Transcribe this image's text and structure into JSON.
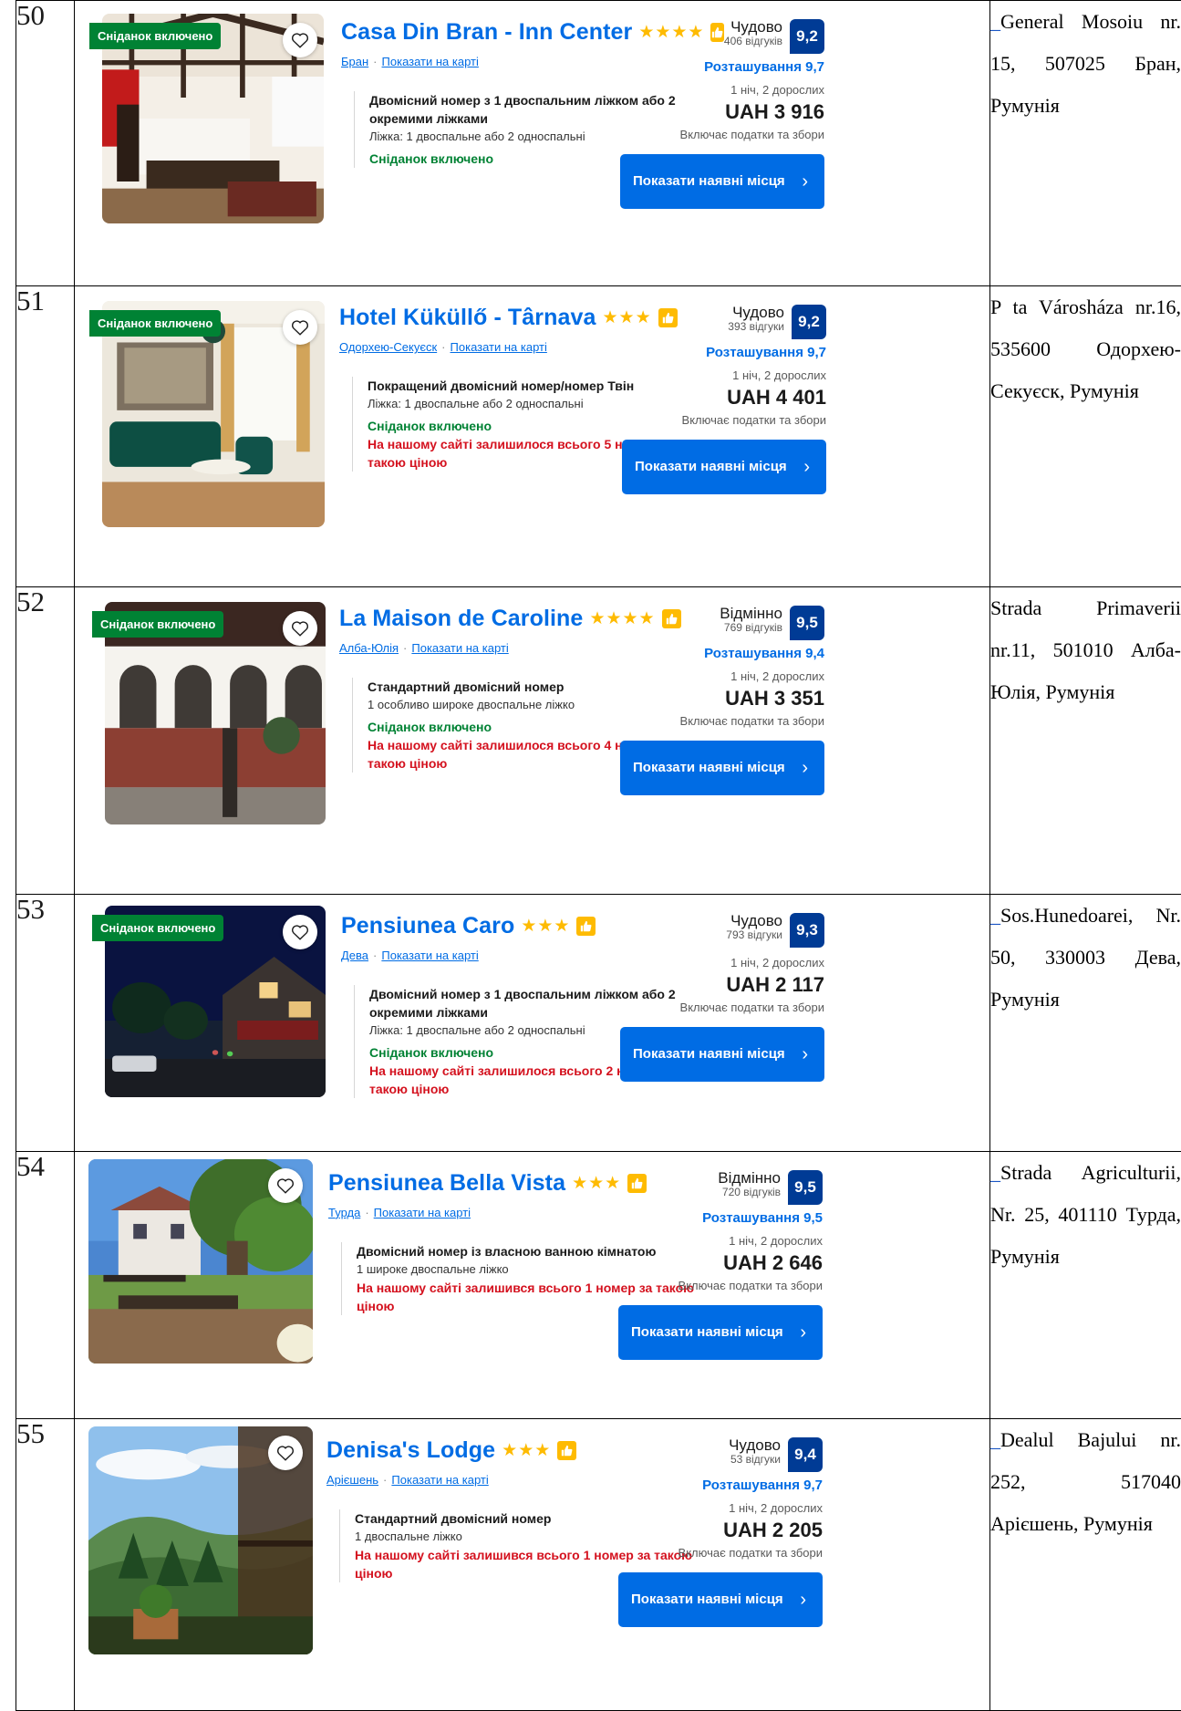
{
  "rows": [
    {
      "num": "50",
      "badge": "Сніданок включено",
      "name": "Casa Din Bran - Inn Center",
      "stars": "★★★★",
      "town": "Бран",
      "map_link": "Показати на карті",
      "rating_word": "Чудово",
      "reviews": "406 відгуків",
      "score": "9,2",
      "location_score": "Розташування 9,7",
      "room": "Двомісний номер з 1 двоспальним ліжком або 2 окремими ліжками",
      "bed": "Ліжка: 1 двоспальне або 2 односпальні",
      "breakfast": "Сніданок включено",
      "scarcity": "",
      "nights": "1 ніч, 2 дорослих",
      "price": "UAH 3 916",
      "taxes": "Включає податки та збори",
      "button": "Показати наявні місця",
      "address": "General Mosoiu nr. 15, 507025 Бран, Румунія",
      "address_mark": "_"
    },
    {
      "num": "51",
      "badge": "Сніданок включено",
      "name": "Hotel Küküllő - Târnava",
      "stars": "★★★",
      "town": "Одорхею-Секуєск",
      "map_link": "Показати на карті",
      "rating_word": "Чудово",
      "reviews": "393 відгуки",
      "score": "9,2",
      "location_score": "Розташування 9,7",
      "room": "Покращений двомісний номер/номер Твін",
      "bed": "Ліжка: 1 двоспальне або 2 односпальні",
      "breakfast": "Сніданок включено",
      "scarcity": "На нашому сайті залишилося всього 5 номерів за такою ціною",
      "nights": "1 ніч, 2 дорослих",
      "price": "UAH 4 401",
      "taxes": "Включає податки та збори",
      "button": "Показати наявні місця",
      "address": "P ta Városháza nr.16, 535600 Одорхею-Секуєск, Румунія",
      "address_mark": ""
    },
    {
      "num": "52",
      "badge": "Сніданок включено",
      "name": "La Maison de Caroline",
      "stars": "★★★★",
      "town": "Алба-Юлія",
      "map_link": "Показати на карті",
      "rating_word": "Відмінно",
      "reviews": "769 відгуків",
      "score": "9,5",
      "location_score": "Розташування 9,4",
      "room": "Стандартний двомісний номер",
      "bed": "1 особливо широке двоспальне ліжко",
      "breakfast": "Сніданок включено",
      "scarcity": "На нашому сайті залишилося всього 4 номери за такою ціною",
      "nights": "1 ніч, 2 дорослих",
      "price": "UAH 3 351",
      "taxes": "Включає податки та збори",
      "button": "Показати наявні місця",
      "address": "Strada Primaverii nr.11, 501010 Алба-Юлія, Румунія",
      "address_mark": ""
    },
    {
      "num": "53",
      "badge": "Сніданок включено",
      "name": "Pensiunea Caro",
      "stars": "★★★",
      "town": "Дева",
      "map_link": "Показати на карті",
      "rating_word": "Чудово",
      "reviews": "793 відгуки",
      "score": "9,3",
      "location_score": "",
      "room": "Двомісний номер з 1 двоспальним ліжком або 2 окремими ліжками",
      "bed": "Ліжка: 1 двоспальне або 2 односпальні",
      "breakfast": "Сніданок включено",
      "scarcity": "На нашому сайті залишилося всього 2 номери за такою ціною",
      "nights": "1 ніч, 2 дорослих",
      "price": "UAH 2 117",
      "taxes": "Включає податки та збори",
      "button": "Показати наявні місця",
      "address": "Sos.Hunedoarei, Nr. 50, 330003 Дева, Румунія",
      "address_mark": "_"
    },
    {
      "num": "54",
      "badge": "",
      "name": "Pensiunea Bella Vista",
      "stars": "★★★",
      "town": "Турда",
      "map_link": "Показати на карті",
      "rating_word": "Відмінно",
      "reviews": "720 відгуків",
      "score": "9,5",
      "location_score": "Розташування 9,5",
      "room": "Двомісний номер із власною ванною кімнатою",
      "bed": "1 широке двоспальне ліжко",
      "breakfast": "",
      "scarcity": "На нашому сайті залишився всього 1 номер за такою ціною",
      "nights": "1 ніч, 2 дорослих",
      "price": "UAH 2 646",
      "taxes": "Включає податки та збори",
      "button": "Показати наявні місця",
      "address": "Strada Agriculturii, Nr. 25, 401110 Турда, Румунія",
      "address_mark": "_"
    },
    {
      "num": "55",
      "badge": "",
      "name": "Denisa's Lodge",
      "stars": "★★★",
      "town": "Арієшень",
      "map_link": "Показати на карті",
      "rating_word": "Чудово",
      "reviews": "53 відгуки",
      "score": "9,4",
      "location_score": "Розташування 9,7",
      "room": "Стандартний двомісний номер",
      "bed": "1 двоспальне ліжко",
      "breakfast": "",
      "scarcity": "На нашому сайті залишився всього 1 номер за такою ціною",
      "nights": "1 ніч, 2 дорослих",
      "price": "UAH 2 205",
      "taxes": "Включає податки та збори",
      "button": "Показати наявні місця",
      "address": "Dealul Bajului nr. 252, 517040 Арієшень, Румунія",
      "address_mark": "_"
    }
  ],
  "colors": {
    "brand_blue": "#006ce4",
    "score_blue": "#003b95",
    "breakfast_green": "#008234",
    "scarcity_red": "#d4111e",
    "star_yellow": "#febb02"
  },
  "icons": [
    "heart-icon",
    "thumbs-up-icon",
    "chevron-right-icon"
  ]
}
